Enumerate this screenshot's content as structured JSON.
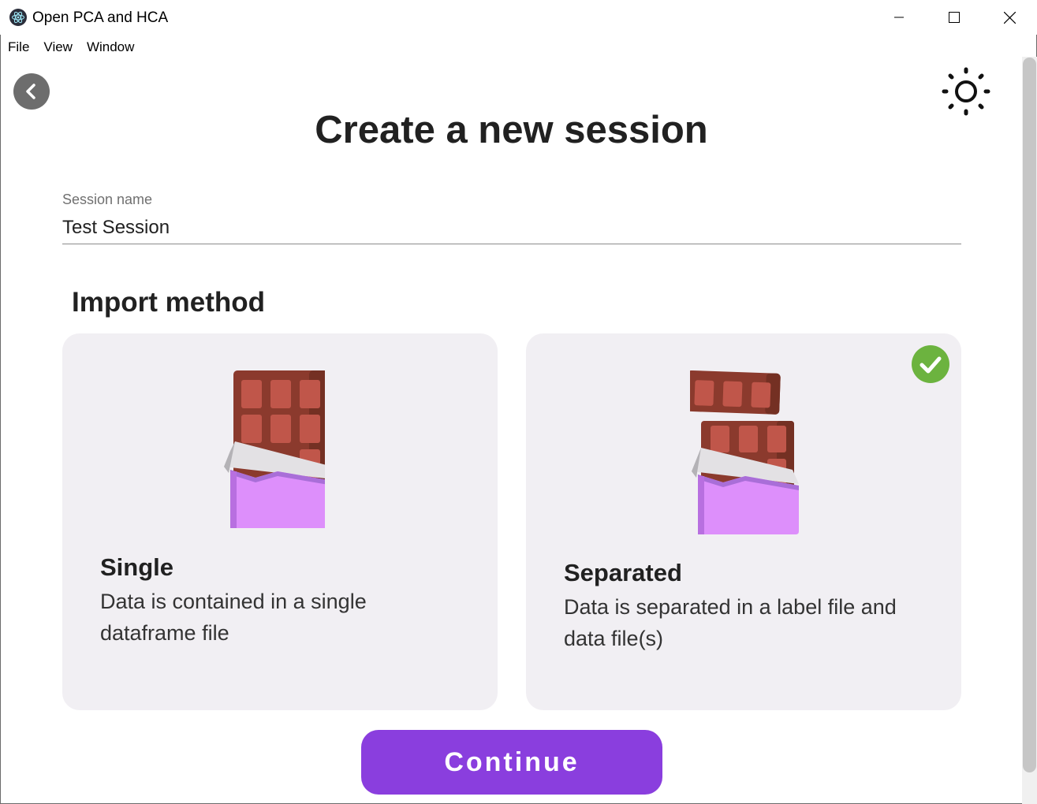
{
  "window": {
    "title": "Open PCA and HCA",
    "icon": "electron-atom-icon",
    "controls": [
      "minimize-icon",
      "maximize-icon",
      "close-icon"
    ]
  },
  "menu": {
    "items": [
      "File",
      "View",
      "Window"
    ]
  },
  "header": {
    "back_icon": "chevron-left-icon",
    "theme_icon": "sun-icon",
    "title": "Create a new session"
  },
  "session": {
    "label": "Session name",
    "value": "Test Session"
  },
  "import": {
    "heading": "Import method",
    "options": [
      {
        "title": "Single",
        "description": "Data is contained in a single dataframe file",
        "illustration": "chocolate-bar-icon",
        "selected": false
      },
      {
        "title": "Separated",
        "description": "Data is separated in a label file and data file(s)",
        "illustration": "broken-chocolate-bar-icon",
        "selected": true
      }
    ]
  },
  "actions": {
    "continue_label": "Continue"
  },
  "colors": {
    "accent": "#8a3ede",
    "card_bg": "#f1eff3",
    "check": "#6cb33f",
    "chocolate": "#8b3a2d",
    "wrapper": "#dd8ffb"
  }
}
